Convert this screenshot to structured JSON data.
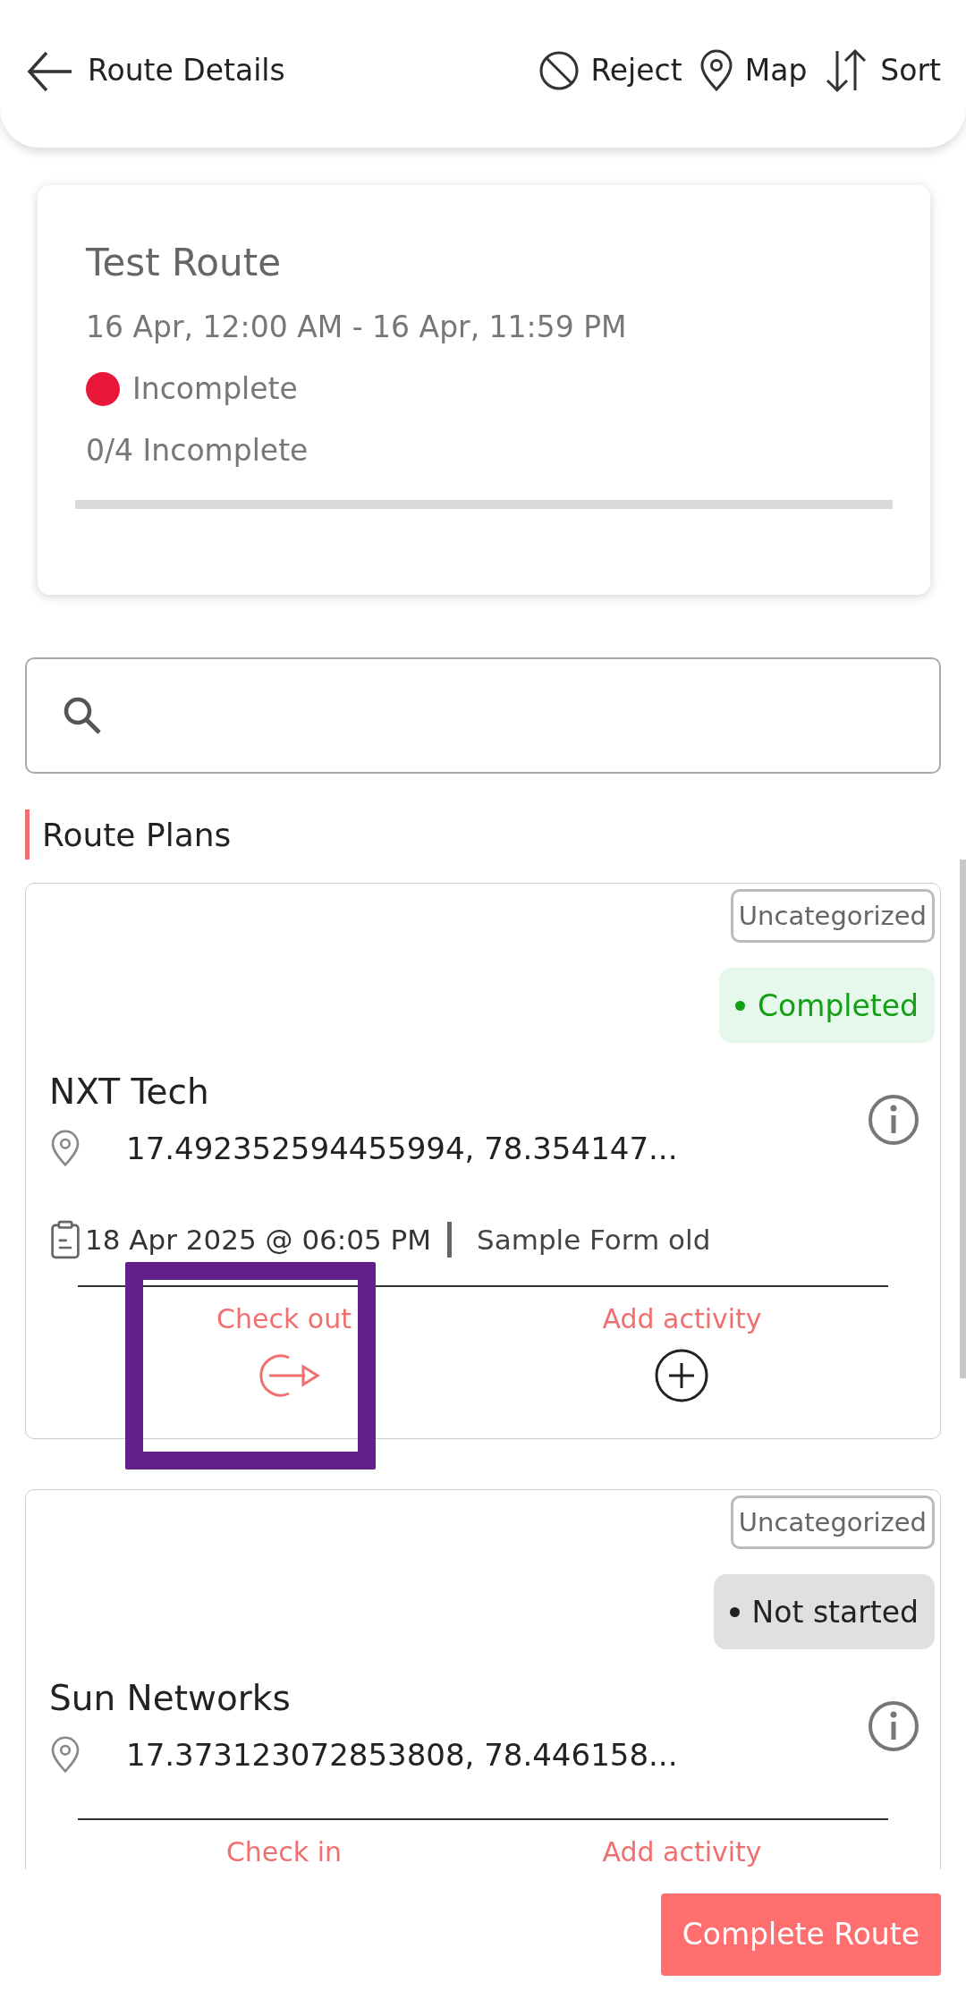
{
  "header": {
    "title": "Route Details",
    "actions": [
      {
        "kind": "reject",
        "label": "Reject"
      },
      {
        "kind": "map",
        "label": "Map"
      },
      {
        "kind": "sort",
        "label": "Sort"
      }
    ]
  },
  "route": {
    "name": "Test Route",
    "period": "16 Apr, 12:00 AM - 16 Apr, 11:59 PM",
    "status": {
      "label": "Incomplete",
      "color": "#e8173a"
    },
    "progress_text": "0/4 Incomplete",
    "level": 0
  },
  "section_title": "Route Plans",
  "plans": [
    {
      "category": "Uncategorized",
      "status": {
        "kind": "completed",
        "label": "Completed"
      },
      "name": "NXT Tech",
      "location": "17.492352594455994, 78.354147...",
      "form": {
        "date": "18 Apr 2025 @ 06:05 PM",
        "name": "Sample Form old"
      },
      "actions": [
        {
          "kind": "checkout",
          "label": "Check out",
          "highlighted": true,
          "icon_shown": true
        },
        {
          "kind": "add",
          "label": "Add activity",
          "highlighted": false,
          "icon_shown": true
        }
      ]
    },
    {
      "category": "Uncategorized",
      "status": {
        "kind": "not_started",
        "label": "Not started"
      },
      "name": "Sun Networks",
      "location": "17.373123072853808, 78.446158...",
      "actions": [
        {
          "kind": "checkin",
          "label": "Check in",
          "highlighted": false,
          "icon_shown": false
        },
        {
          "kind": "add",
          "label": "Add activity",
          "highlighted": false,
          "icon_shown": false
        }
      ]
    }
  ],
  "footer_button": "Complete Route"
}
